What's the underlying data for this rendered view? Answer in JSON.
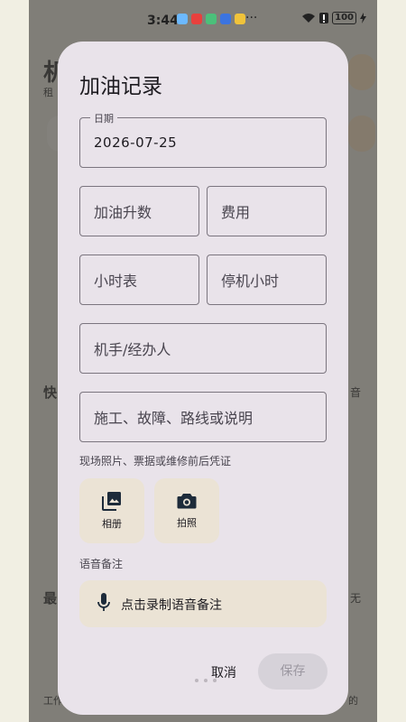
{
  "status_bar": {
    "time": "3:44",
    "battery": "100",
    "overflow": "···"
  },
  "background_peek": {
    "title_char": "机",
    "subtitle_char": "租",
    "section_quick": "快",
    "section_recent": "最",
    "right_text_1": "音",
    "right_text_2": "无",
    "nav_left": "工作",
    "nav_right": "的"
  },
  "dialog": {
    "title": "加油记录",
    "date_field": {
      "label": "日期",
      "value": "2026-07-25"
    },
    "liters_field": {
      "placeholder": "加油升数"
    },
    "cost_field": {
      "placeholder": "费用"
    },
    "hour_meter_field": {
      "placeholder": "小时表"
    },
    "idle_hours_field": {
      "placeholder": "停机小时"
    },
    "operator_field": {
      "placeholder": "机手/经办人"
    },
    "notes_field": {
      "placeholder": "施工、故障、路线或说明"
    },
    "photo_hint": "现场照片、票据或维修前后凭证",
    "gallery_button": {
      "label": "相册",
      "icon": "photo-library-icon"
    },
    "camera_button": {
      "label": "拍照",
      "icon": "camera-icon"
    },
    "voice_section_label": "语音备注",
    "voice_button": {
      "label": "点击录制语音备注",
      "icon": "mic-icon"
    },
    "cancel_label": "取消",
    "save_label": "保存"
  },
  "colors": {
    "dialog_bg": "#e9e3ea",
    "tonal_button": "#ebe3d5",
    "outline": "#7b757f",
    "disabled_button": "#d6d2d9"
  }
}
